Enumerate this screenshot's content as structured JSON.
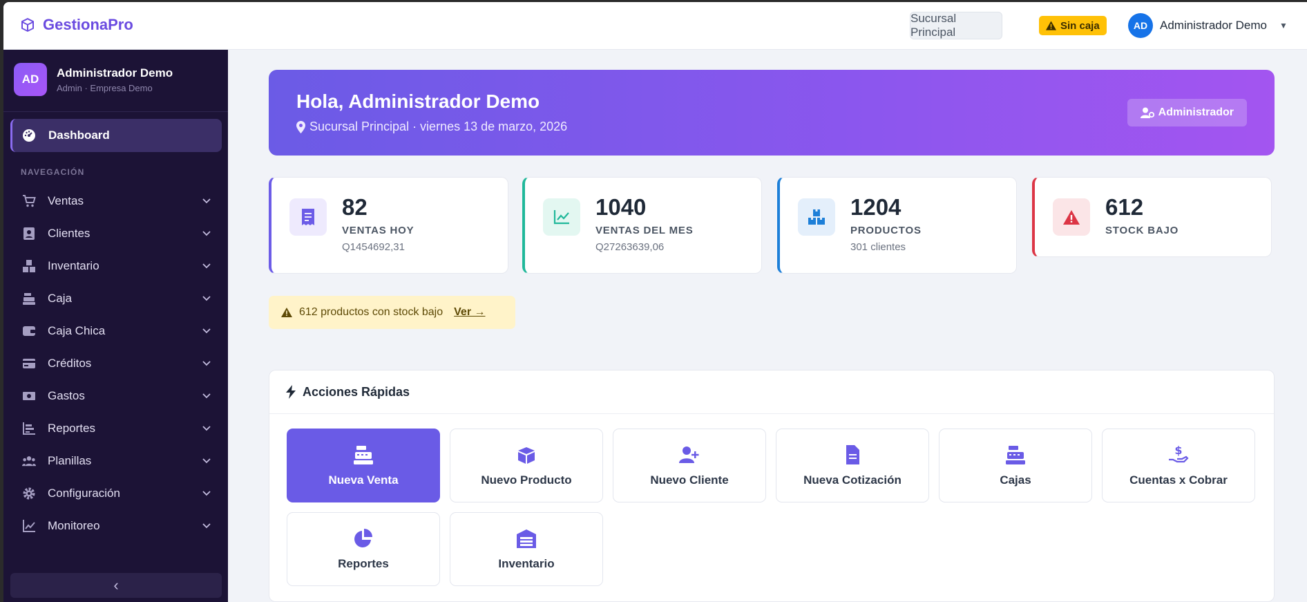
{
  "brand": {
    "name": "GestionaPro"
  },
  "topbar": {
    "branch": "Sucursal Principal",
    "cash_status": "Sin caja",
    "user_initials": "AD",
    "user_name": "Administrador Demo"
  },
  "sidebar": {
    "user_initials": "AD",
    "user_name": "Administrador Demo",
    "user_role": "Admin · Empresa Demo",
    "dashboard": "Dashboard",
    "section": "NAVEGACIÓN",
    "items": [
      {
        "label": "Ventas",
        "icon": "cart-icon"
      },
      {
        "label": "Clientes",
        "icon": "contact-card-icon"
      },
      {
        "label": "Inventario",
        "icon": "boxes-icon"
      },
      {
        "label": "Caja",
        "icon": "cash-register-icon"
      },
      {
        "label": "Caja Chica",
        "icon": "wallet-icon"
      },
      {
        "label": "Créditos",
        "icon": "credit-card-icon"
      },
      {
        "label": "Gastos",
        "icon": "money-bill-icon"
      },
      {
        "label": "Reportes",
        "icon": "bar-chart-icon"
      },
      {
        "label": "Planillas",
        "icon": "users-icon"
      },
      {
        "label": "Configuración",
        "icon": "gear-icon"
      },
      {
        "label": "Monitoreo",
        "icon": "line-chart-icon"
      }
    ],
    "collapse": "‹"
  },
  "hero": {
    "title": "Hola, Administrador Demo",
    "subtitle": "Sucursal Principal · viernes 13 de marzo, 2026",
    "badge": "Administrador"
  },
  "stats": [
    {
      "value": "82",
      "label": "VENTAS HOY",
      "sub": "Q1454692,31",
      "accent": "#6c5ce7"
    },
    {
      "value": "1040",
      "label": "VENTAS DEL MES",
      "sub": "Q27263639,06",
      "accent": "#20b89a"
    },
    {
      "value": "1204",
      "label": "PRODUCTOS",
      "sub": "301 clientes",
      "accent": "#1d7fd8"
    },
    {
      "value": "612",
      "label": "STOCK BAJO",
      "sub": "",
      "accent": "#dc3545"
    }
  ],
  "alert": {
    "text": "612 productos con stock bajo",
    "link": "Ver →"
  },
  "quick_actions": {
    "title": "Acciones Rápidas",
    "buttons": [
      {
        "label": "Nueva Venta",
        "icon": "cash-register-icon"
      },
      {
        "label": "Nuevo Producto",
        "icon": "open-box-icon"
      },
      {
        "label": "Nuevo Cliente",
        "icon": "user-plus-icon"
      },
      {
        "label": "Nueva Cotización",
        "icon": "file-icon"
      },
      {
        "label": "Cajas",
        "icon": "cash-register-icon"
      },
      {
        "label": "Cuentas x Cobrar",
        "icon": "hand-dollar-icon"
      },
      {
        "label": "Reportes",
        "icon": "pie-chart-icon"
      },
      {
        "label": "Inventario",
        "icon": "warehouse-icon"
      }
    ]
  }
}
